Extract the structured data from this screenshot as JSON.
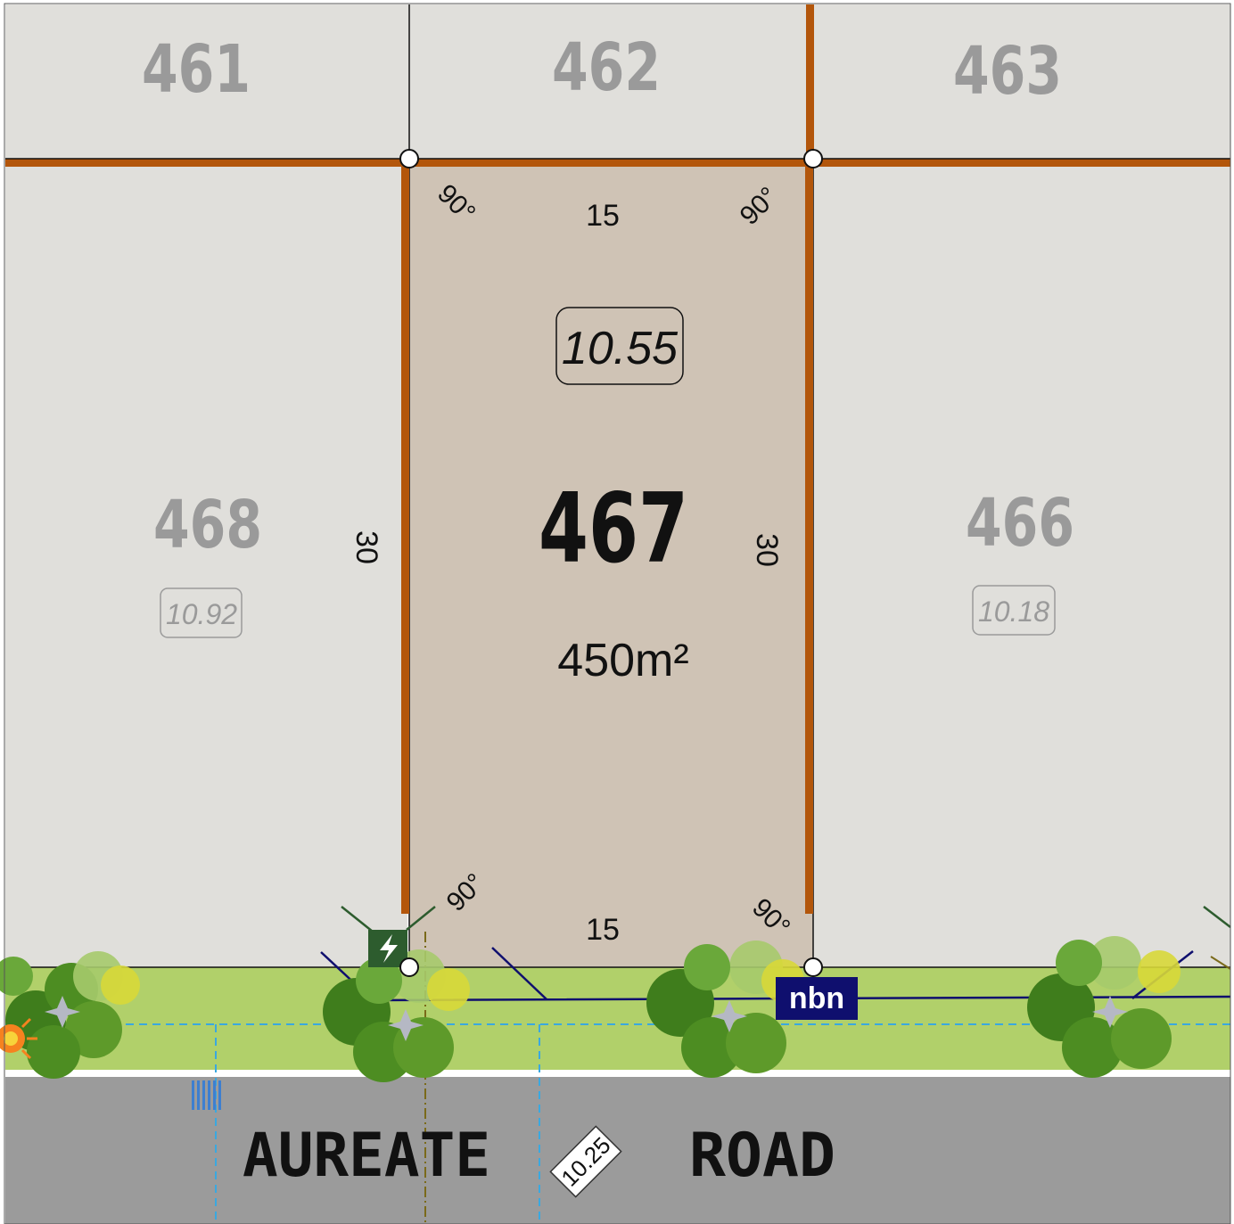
{
  "map": {
    "lots": {
      "lot_461": "461",
      "lot_462": "462",
      "lot_463": "463",
      "lot_468": "468",
      "lot_466": "466",
      "lot_467": "467"
    },
    "feature_lot": {
      "number": "467",
      "area": "450m²",
      "level": "10.55",
      "frontage_top": "15",
      "frontage_bottom": "15",
      "depth_left": "30",
      "depth_right": "30",
      "angle_tl": "90°",
      "angle_tr": "90°",
      "angle_bl": "90°",
      "angle_br": "90°"
    },
    "levels": {
      "lot_468": "10.92",
      "lot_466": "10.18",
      "road": "10.25"
    },
    "road": {
      "name_part1": "AUREATE",
      "name_part2": "ROAD"
    },
    "services": {
      "nbn_label": "nbn",
      "power_icon": "lightning-bolt-icon"
    },
    "colors": {
      "background_lot": "#e0dfdb",
      "feature_lot": "#cfc3b5",
      "boundary": "#b3560b",
      "verge": "#b1d06a",
      "road": "#9b9b9b",
      "nbn": "#0f0f6e",
      "power_box": "#2d5c2e",
      "service_dash": "#3aa8e0"
    }
  }
}
